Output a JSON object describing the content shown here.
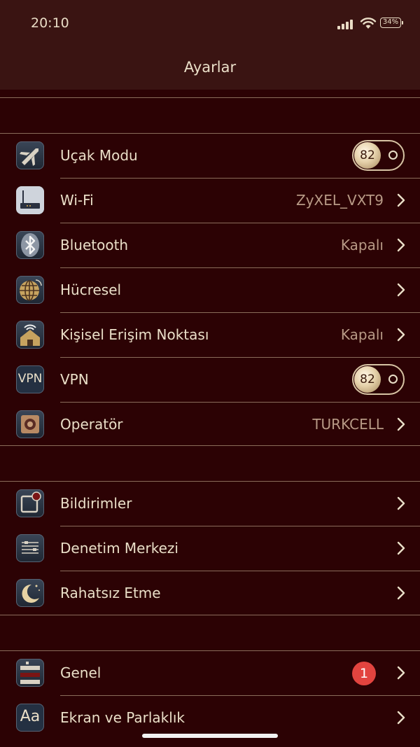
{
  "status_bar": {
    "time": "20:10",
    "battery": "34%"
  },
  "nav": {
    "title": "Ayarlar"
  },
  "group1": {
    "airplane": {
      "label": "Uçak Modu",
      "toggle_knob": "82"
    },
    "wifi": {
      "label": "Wi-Fi",
      "value": "ZyXEL_VXT9"
    },
    "bluetooth": {
      "label": "Bluetooth",
      "value": "Kapalı"
    },
    "cellular": {
      "label": "Hücresel"
    },
    "hotspot": {
      "label": "Kişisel Erişim Noktası",
      "value": "Kapalı"
    },
    "vpn": {
      "label": "VPN",
      "icon_text": "VPN",
      "toggle_knob": "82"
    },
    "carrier": {
      "label": "Operatör",
      "value": "TURKCELL"
    }
  },
  "group2": {
    "notifications": {
      "label": "Bildirimler"
    },
    "control_center": {
      "label": "Denetim Merkezi"
    },
    "dnd": {
      "label": "Rahatsız Etme"
    }
  },
  "group3": {
    "general": {
      "label": "Genel",
      "badge": "1"
    },
    "display": {
      "label": "Ekran ve Parlaklık",
      "icon_text": "Aa"
    }
  },
  "colors": {
    "background": "#2c0204",
    "header": "#3a1412",
    "text": "#eadfc8",
    "secondary_text": "#b89a86",
    "separator": "#8a6c5a",
    "badge": "#e2443f"
  },
  "icons": {
    "airplane": "airplane-icon",
    "wifi": "router-icon",
    "bluetooth": "bluetooth-icon",
    "cellular": "globe-icon",
    "hotspot": "house-hotspot-icon",
    "carrier": "operator-icon",
    "notifications": "notification-icon",
    "control_center": "sliders-icon",
    "dnd": "moon-icon",
    "general": "gear-panel-icon"
  }
}
